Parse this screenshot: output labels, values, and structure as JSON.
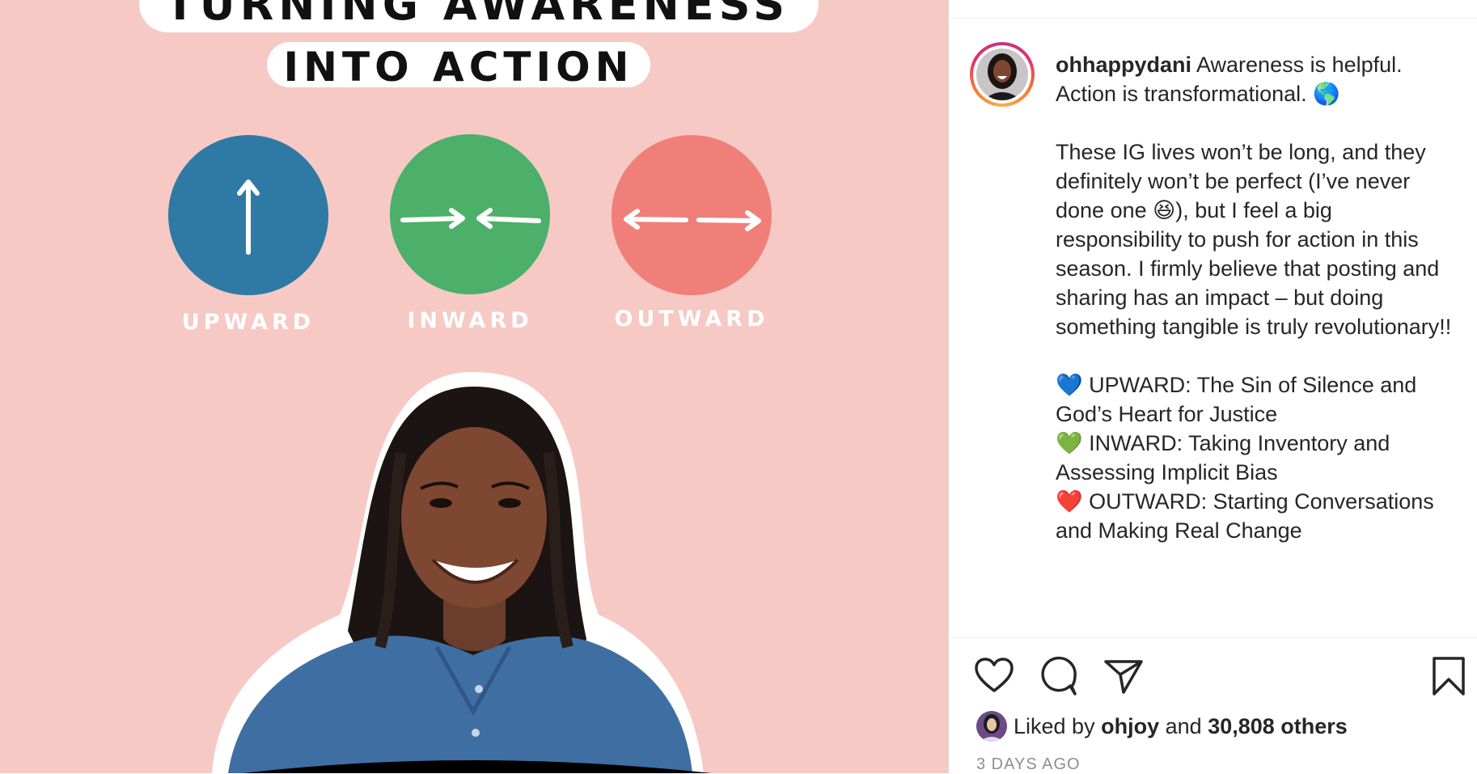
{
  "image": {
    "title_line1": "TURNING AWARENESS",
    "title_line2": "INTO ACTION",
    "circles": [
      {
        "label": "UPWARD",
        "color": "#2e7aa5",
        "icon": "arrow-up-icon"
      },
      {
        "label": "INWARD",
        "color": "#4cb06a",
        "icon": "arrows-inward-icon"
      },
      {
        "label": "OUTWARD",
        "color": "#ef7f78",
        "icon": "arrows-outward-icon"
      }
    ],
    "background_color": "#f7c9c4"
  },
  "post": {
    "username": "ohhappydani",
    "caption_lines": [
      "Awareness is helpful. Action is transformational. 🌎",
      "These IG lives won’t be long, and they definitely won’t be perfect (I’ve never done one 😆), but I feel a big responsibility to push for action in this season. I firmly believe that posting and sharing has an impact – but doing something tangible is truly revolutionary!!",
      "💙 UPWARD: The Sin of Silence and God’s Heart for Justice",
      "💚 INWARD: Taking Inventory and Assessing Implicit Bias",
      "❤️ OUTWARD: Starting Conversations and Making Real Change"
    ],
    "liked_by_prefix": "Liked by",
    "liked_by_user": "ohjoy",
    "liked_by_and": "and",
    "liked_by_others": "30,808 others",
    "timestamp": "3 DAYS AGO"
  },
  "actions": {
    "like_icon": "heart-icon",
    "comment_icon": "comment-icon",
    "share_icon": "share-icon",
    "save_icon": "bookmark-icon"
  }
}
